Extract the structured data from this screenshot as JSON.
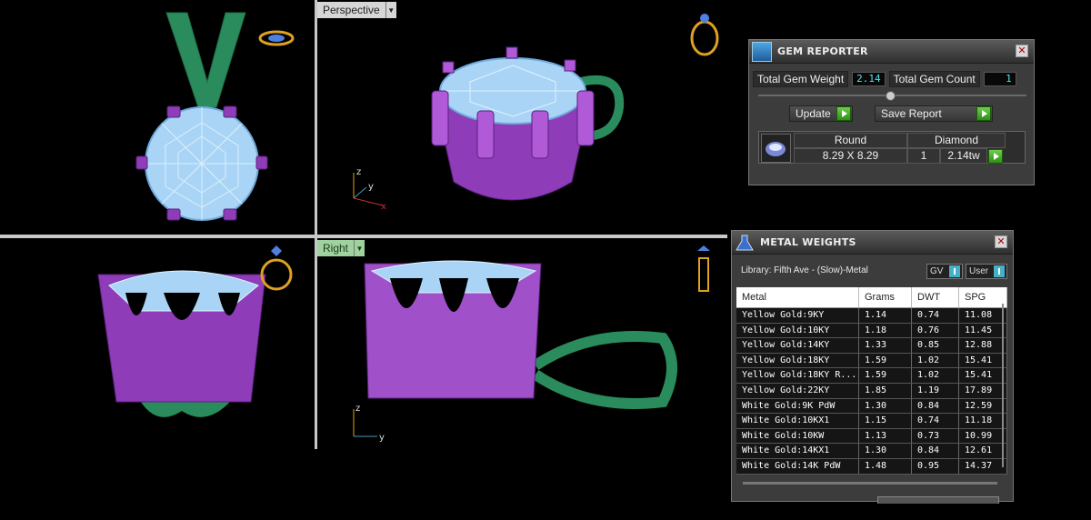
{
  "viewports": {
    "top_right_label": "Perspective",
    "bottom_left_label": "Right",
    "axes": {
      "z": "z",
      "y": "y",
      "x": "x"
    }
  },
  "gem_reporter": {
    "title": "GEM REPORTER",
    "total_weight_label": "Total Gem Weight",
    "total_weight_value": "2.14",
    "total_count_label": "Total Gem Count",
    "total_count_value": "1",
    "update_label": "Update",
    "save_label": "Save Report",
    "table": {
      "shape": "Round",
      "stone": "Diamond",
      "size": "8.29 X 8.29",
      "count": "1",
      "weight": "2.14tw"
    }
  },
  "metal_weights": {
    "title": "METAL WEIGHTS",
    "library": "Library: Fifth Ave - (Slow)-Metal",
    "select_gv": "GV",
    "select_user": "User",
    "columns": [
      "Metal",
      "Grams",
      "DWT",
      "SPG"
    ],
    "rows": [
      [
        "Yellow Gold:9KY",
        "1.14",
        "0.74",
        "11.08"
      ],
      [
        "Yellow Gold:10KY",
        "1.18",
        "0.76",
        "11.45"
      ],
      [
        "Yellow Gold:14KY",
        "1.33",
        "0.85",
        "12.88"
      ],
      [
        "Yellow Gold:18KY",
        "1.59",
        "1.02",
        "15.41"
      ],
      [
        "Yellow Gold:18KY R...",
        "1.59",
        "1.02",
        "15.41"
      ],
      [
        "Yellow Gold:22KY",
        "1.85",
        "1.19",
        "17.89"
      ],
      [
        "White Gold:9K PdW",
        "1.30",
        "0.84",
        "12.59"
      ],
      [
        "White Gold:10KX1",
        "1.15",
        "0.74",
        "11.18"
      ],
      [
        "White Gold:10KW",
        "1.13",
        "0.73",
        "10.99"
      ],
      [
        "White Gold:14KX1",
        "1.30",
        "0.84",
        "12.61"
      ],
      [
        "White Gold:14K PdW",
        "1.48",
        "0.95",
        "14.37"
      ]
    ]
  }
}
